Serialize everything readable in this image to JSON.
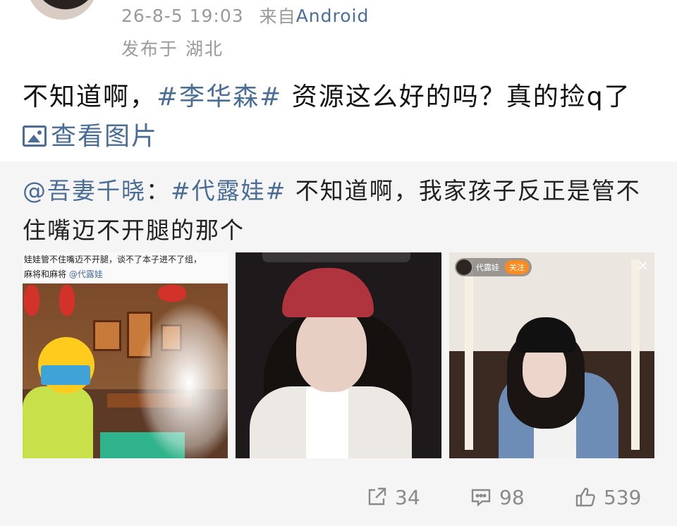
{
  "post": {
    "timestamp": "26-8-5 19:03",
    "source_prefix": "来自",
    "source": "Android",
    "location": "发布于 湖北",
    "text_before": "不知道啊，",
    "hashtag": "#李华森#",
    "text_after": " 资源这么好的吗？真的捡q了 ",
    "view_image_label": "查看图片"
  },
  "repost": {
    "mention": "@吾妻千晓",
    "separator": "：",
    "hashtag": "#代露娃#",
    "text": " 不知道啊，我家孩子反正是管不住嘴迈不开腿的那个"
  },
  "photos": [
    {
      "caption_line1": "娃娃管不住嘴迈不开腿，谈不了本子进不了组，",
      "caption_line2_prefix": "麻将和麻将",
      "caption_mention": "@代露娃",
      "icon": "emoji-reading-book-icon"
    },
    {
      "icon": "photo"
    },
    {
      "live_name": "代露娃",
      "follow_label": "关注",
      "close_label": "×"
    }
  ],
  "actions": {
    "repost_count": "34",
    "comment_count": "98",
    "like_count": "539"
  },
  "colors": {
    "link": "#4a6d96",
    "meta": "#9a9a9a",
    "repost_bg": "#f5f5f5"
  }
}
